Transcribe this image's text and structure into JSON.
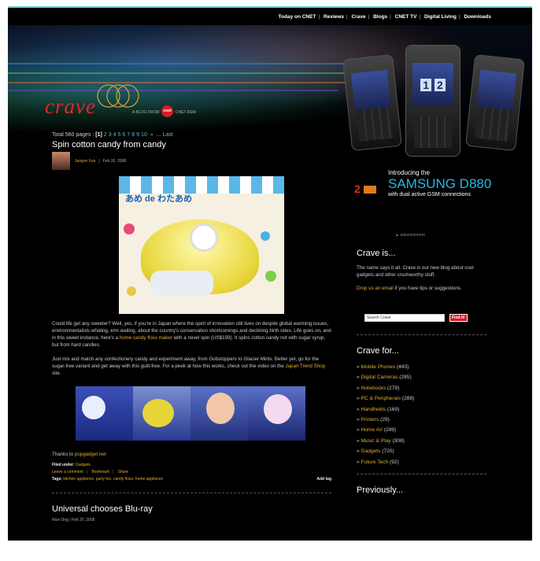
{
  "nav": {
    "items": [
      "Today on CNET",
      "Reviews",
      "Crave",
      "Blogs",
      "CNET TV",
      "Digital Living",
      "Downloads"
    ]
  },
  "header": {
    "logo": "crave",
    "tagline": "A BLOG FROM",
    "badge": "cnet",
    "tagline_suffix": "CNET ASIA"
  },
  "ad": {
    "intro": "Introducing the",
    "model": "SAMSUNG D880",
    "sub": "with dual active GSM connections",
    "screen_numbers": [
      "1",
      "2"
    ],
    "label": "advertisement"
  },
  "pager": {
    "prefix": "Total 560 pages :",
    "current": "[1]",
    "pages": [
      "2",
      "3",
      "4",
      "5",
      "6",
      "7",
      "8",
      "9",
      "10"
    ],
    "next": "»",
    "ellipsis": "...",
    "last": "Last"
  },
  "post1": {
    "title": "Spin cotton candy from candy",
    "author": "Juniper Foo",
    "date": "Feb 20, 2008",
    "photo_caption": "あめ de わたあめ",
    "para1_a": "Could life get any sweeter? Well, yes, if you're in Japan where the spirit of innovation still lives on despite global warming issues, environmentalists whaling, erm wailing, about the country's conservation shortcomings and declining birth rates. Life goes on, and in this sweet instance, here's a ",
    "para1_link": "home candy floss maker",
    "para1_b": " with a novel spin (US$159). It spins cotton candy not with sugar syrup, but from hard candies.",
    "para2_a": "Just mix and match any confectionery candy and experiment away, from Gobstoppers to Glacier Mints. Better yet, go for the sugar-free variant and get away with this guilt-free. For a peek at how this works, check out the video on the ",
    "para2_link": "Japan Trend Shop",
    "para2_b": " site.",
    "thanks_prefix": "Thanks to ",
    "thanks_link": "popgadget.net",
    "filed_label": "Filed under:",
    "filed": "Gadgets",
    "actions": [
      "Leave a comment",
      "Bookmark",
      "Share"
    ],
    "tags_label": "Tags:",
    "tags": "kitchen appliance, party fun, candy floss, home appliance",
    "add_tag": "Add tag"
  },
  "post2": {
    "title": "Universal chooses Blu-ray",
    "author": "Nice Ong",
    "date": "Feb 20, 2008"
  },
  "sidebar": {
    "about_title": "Crave is...",
    "about_text": "The name says it all. Crave is our new blog about cool gadgets and other crushworthy stuff.",
    "email_link": "Drop us an email",
    "email_suffix": " if you have tips or suggestions.",
    "search_value": "Search Crave",
    "search_button": "Find it!",
    "for_title": "Crave for...",
    "categories": [
      {
        "name": "Mobile Phones",
        "count": "(443)"
      },
      {
        "name": "Digital Cameras",
        "count": "(285)"
      },
      {
        "name": "Notebooks",
        "count": "(279)"
      },
      {
        "name": "PC & Peripherals",
        "count": "(288)"
      },
      {
        "name": "Handhelds",
        "count": "(169)"
      },
      {
        "name": "Printers",
        "count": "(29)"
      },
      {
        "name": "Home AV",
        "count": "(289)"
      },
      {
        "name": "Music & Play",
        "count": "(308)"
      },
      {
        "name": "Gadgets",
        "count": "(720)"
      },
      {
        "name": "Future Tech",
        "count": "(92)"
      }
    ],
    "previously_title": "Previously..."
  }
}
